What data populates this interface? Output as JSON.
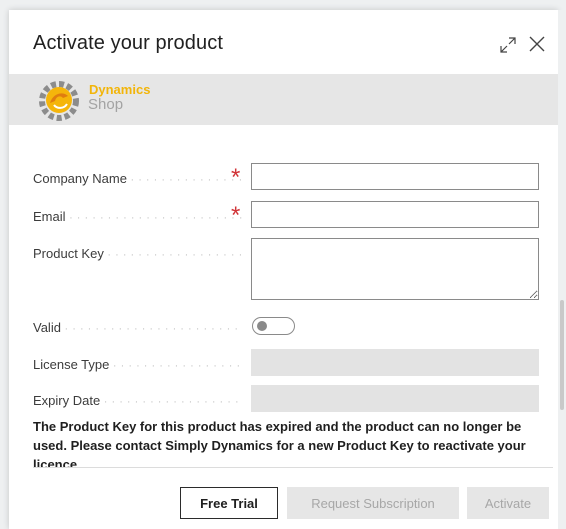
{
  "dialog": {
    "title": "Activate your product",
    "expand_icon": "expand-icon",
    "close_icon": "close-icon"
  },
  "logo": {
    "brand": "Dynamics",
    "sub": "Shop"
  },
  "form": {
    "company_name": {
      "label": "Company Name",
      "value": "",
      "required": true
    },
    "email": {
      "label": "Email",
      "value": "",
      "required": true
    },
    "product_key": {
      "label": "Product Key",
      "value": ""
    },
    "valid": {
      "label": "Valid",
      "on": false
    },
    "license_type": {
      "label": "License Type",
      "value": ""
    },
    "expiry_date": {
      "label": "Expiry Date",
      "value": ""
    },
    "required_marker": "*"
  },
  "message": "The Product Key for this product has expired and the product can no longer be used. Please contact Simply Dynamics for a new Product Key to reactivate your licence.",
  "buttons": {
    "free_trial": "Free Trial",
    "request_subscription": "Request Subscription",
    "activate": "Activate"
  },
  "colors": {
    "required": "#d13438",
    "brand_accent": "#f2b50a",
    "disabled_bg": "#e6e6e6"
  }
}
